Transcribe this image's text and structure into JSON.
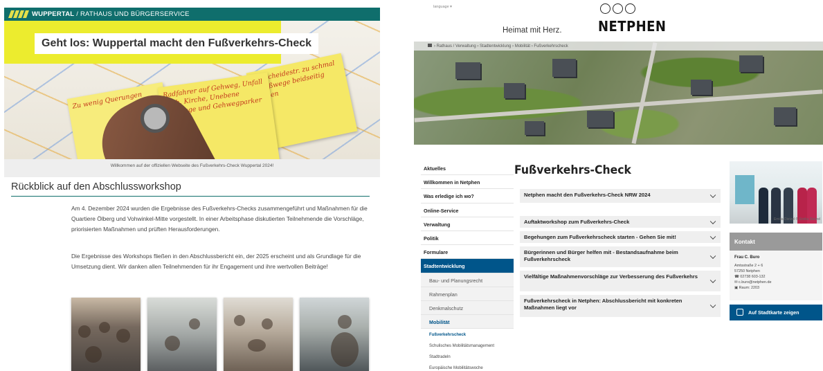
{
  "left": {
    "header": {
      "brand": "WUPPERTAL",
      "rest": " / RATHAUS UND BÜRGERSERVICE"
    },
    "hero": {
      "title": "Geht los: Wuppertal macht den Fußverkehrs-Check",
      "notes": [
        "Radfahrer auf Gehweg, Unfall Kath. Kirche, Unebene Gehwege und Gehwegparker",
        "Rollscheidestr. zu schmal f. Fußwege beidseitig parken",
        "Zu wenig Querungen"
      ]
    },
    "caption": "Willkommen auf der offiziellen Webseite des Fußverkehrs-Check Wuppertal 2024!",
    "section_title": "Rückblick auf den Abschlussworkshop",
    "paragraph1": "Am 4. Dezember 2024 wurden die Ergebnisse des Fußverkehrs-Checks zusammengeführt und Maßnahmen für die Quartiere Ölberg und Vohwinkel-Mitte vorgestellt. In einer Arbeitsphase diskutierten Teilnehmende die Vorschläge, priorisierten Maßnahmen und prüften Herausforderungen.",
    "paragraph2": "Die Ergebnisse des Workshops fließen in den Abschlussbericht ein, der 2025 erscheint und als Grundlage für die Umsetzung dient. Wir danken allen Teilnehmenden für ihr Engagement und ihre wertvollen Beiträge!"
  },
  "right": {
    "language": "language ▾",
    "slogan": "Heimat mit Herz.",
    "logo": "NETPHEN",
    "breadcrumb": "› Rathaus / Verwaltung › Stadtentwicklung › Mobilität › Fußverkehrscheck",
    "nav": [
      {
        "label": "Aktuelles",
        "kind": "top"
      },
      {
        "label": "Willkommen in Netphen",
        "kind": "top"
      },
      {
        "label": "Was erledige ich wo?",
        "kind": "top"
      },
      {
        "label": "Online-Service",
        "kind": "top"
      },
      {
        "label": "Verwaltung",
        "kind": "top"
      },
      {
        "label": "Politik",
        "kind": "top"
      },
      {
        "label": "Formulare",
        "kind": "top"
      },
      {
        "label": "Stadtentwicklung",
        "kind": "active"
      },
      {
        "label": "Bau- und Planungsrecht",
        "kind": "sub"
      },
      {
        "label": "Rahmenplan",
        "kind": "sub"
      },
      {
        "label": "Denkmalschutz",
        "kind": "sub"
      },
      {
        "label": "Mobilität",
        "kind": "subactive"
      },
      {
        "label": "Fußverkehrscheck",
        "kind": "sub2a"
      },
      {
        "label": "Schulisches Mobilitätsmanagement",
        "kind": "sub2"
      },
      {
        "label": "Stadtradeln",
        "kind": "sub2"
      },
      {
        "label": "Europäische Mobilitätswoche",
        "kind": "sub2"
      }
    ],
    "page_title": "Fußverkehrs-Check",
    "accordion": [
      "Netphen macht den Fußverkehrs-Check NRW 2024",
      "Auftaktworkshop zum Fußverkehrs-Check",
      "Begehungen zum Fußverkehrscheck starten - Gehen Sie mit!",
      "Bürgerinnen und Bürger helfen mit - Bestandsaufnahme beim Fußverkehrscheck",
      "Vielfältige Maßnahmenvorschläge zur Verbesserung des Fußverkehrs",
      "Fußverkehrscheck in Netphen: Abschlussbericht mit konkreten Maßnahmen liegt vor"
    ],
    "photo_credit": "Emilia Dietzel ® Emilia Dietzel",
    "kontakt": {
      "heading": "Kontakt",
      "name": "Frau C. Buro",
      "lines": [
        "Amtsstraße 2 + 6",
        "57250 Netphen",
        "☎ 02738 603-132",
        "✉ c.buro@netphen.de",
        "▣ Raum: 2203"
      ]
    },
    "map_button": "Auf Stadtkarte zeigen"
  }
}
